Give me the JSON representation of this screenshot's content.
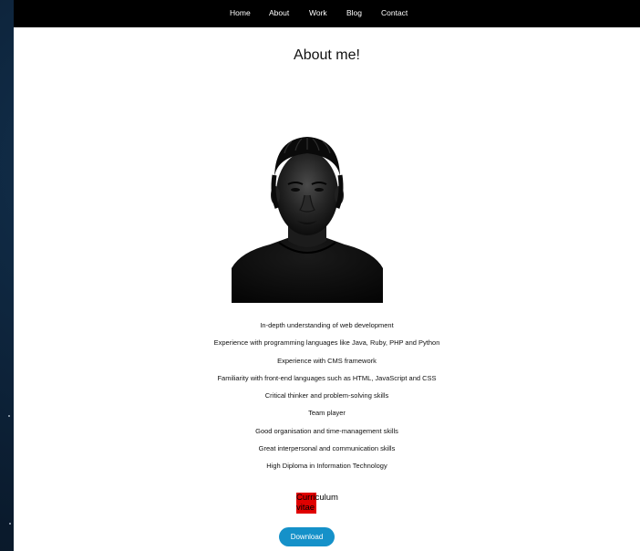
{
  "nav": {
    "items": [
      "Home",
      "About",
      "Work",
      "Blog",
      "Contact"
    ]
  },
  "page": {
    "title": "About me!"
  },
  "profile": {
    "photo_icon": "portrait-photo"
  },
  "skills": [
    "In-depth understanding of web development",
    "Experience with programming languages like Java, Ruby, PHP and Python",
    "Experience with CMS framework",
    "Familiarity with front-end languages such as HTML, JavaScript and CSS",
    "Critical thinker and problem-solving skills",
    "Team player",
    "Good organisation and time-management skills",
    "Great interpersonal and communication skills",
    "High Diploma in Information Technology"
  ],
  "cv": {
    "label_line1": "Curriculum",
    "label_line2": "vitae",
    "download_label": "Download"
  },
  "colors": {
    "navbar": "#000000",
    "download_button": "#1591c9",
    "cv_highlight": "#e00000",
    "outer_background": "#0b1f33"
  }
}
